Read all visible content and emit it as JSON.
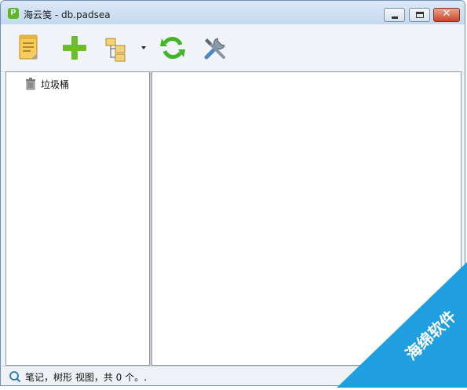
{
  "window": {
    "title": "海云笺 - db.padsea",
    "app_icon_letter": "P"
  },
  "toolbar": {
    "buttons": [
      {
        "name": "note-icon"
      },
      {
        "name": "add-icon"
      },
      {
        "name": "tree-view-icon"
      },
      {
        "name": "refresh-icon"
      },
      {
        "name": "tools-icon"
      }
    ]
  },
  "tree": {
    "items": [
      {
        "label": "垃圾桶",
        "icon": "trash-icon"
      }
    ]
  },
  "status": {
    "text": "笔记，树形 视图，共 0 个。."
  },
  "watermark": {
    "text": "海绵软件",
    "color": "#1f9fe0"
  }
}
